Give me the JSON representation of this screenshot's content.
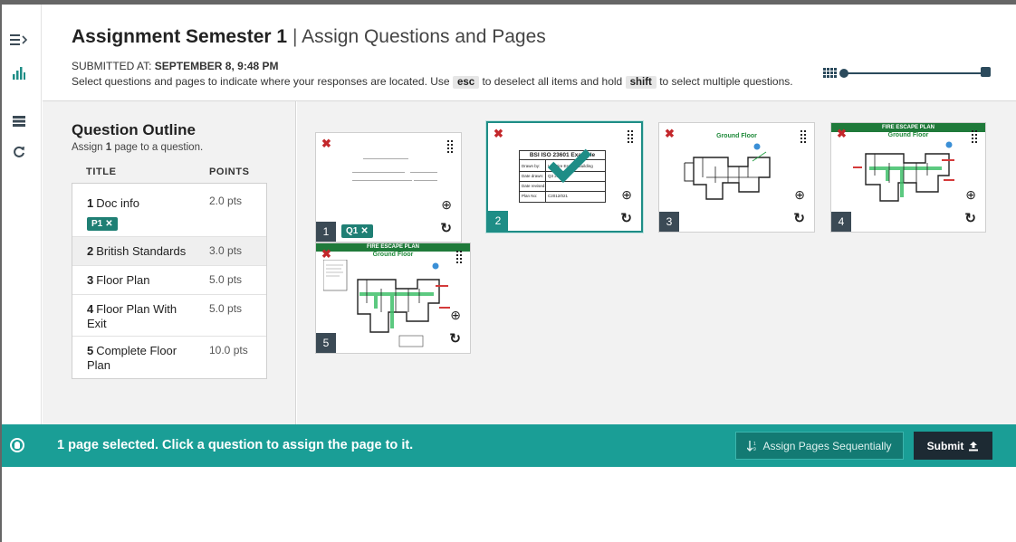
{
  "header": {
    "title_bold": "Assignment Semester 1",
    "title_sep": "|",
    "title_rest": "Assign Questions and Pages",
    "submitted_label": "SUBMITTED AT:",
    "submitted_value": "SEPTEMBER 8, 9:48 PM",
    "instr_1": "Select questions and pages to indicate where your responses are located. Use",
    "key_esc": "esc",
    "instr_2": "to deselect all items and hold",
    "key_shift": "shift",
    "instr_3": "to select multiple questions.",
    "zoom_level": 0.0
  },
  "rail": {
    "icons": [
      "menu-toggle-icon",
      "bar-chart-icon",
      "outline-icon",
      "refresh-icon"
    ]
  },
  "outline": {
    "title": "Question Outline",
    "sub_pre": "Assign",
    "sub_count": "1",
    "sub_post": "page to a question.",
    "col_title": "TITLE",
    "col_points": "POINTS",
    "questions": [
      {
        "num": "1",
        "name": "Doc info",
        "points": "2.0 pts",
        "tag": "P1"
      },
      {
        "num": "2",
        "name": "British Standards",
        "points": "3.0 pts"
      },
      {
        "num": "3",
        "name": "Floor Plan",
        "points": "5.0 pts"
      },
      {
        "num": "4",
        "name": "Floor Plan With Exit",
        "points": "5.0 pts"
      },
      {
        "num": "5",
        "name": "Complete Floor Plan",
        "points": "10.0 pts"
      }
    ]
  },
  "pages": [
    {
      "num": "1",
      "tag": "Q1",
      "selected": false
    },
    {
      "num": "2",
      "selected": true,
      "table_title": "BSI ISO 23601 Example",
      "cells": [
        "Drawn by:",
        "Date drawn:",
        "Date revised:",
        "Plan No:"
      ],
      "cell_values": [
        "Lec Fire Escape Building",
        "Q3 2012",
        "",
        "C2012/021"
      ]
    },
    {
      "num": "3",
      "selected": false,
      "heading": "Ground Floor"
    },
    {
      "num": "4",
      "selected": false,
      "banner": "FIRE ESCAPE PLAN",
      "heading": "Ground Floor"
    },
    {
      "num": "5",
      "selected": false,
      "banner": "FIRE ESCAPE PLAN",
      "heading": "Ground Floor"
    }
  ],
  "bar": {
    "message": "1 page selected. Click a question to assign the page to it.",
    "seq_label": "Assign Pages Sequentially",
    "submit_label": "Submit"
  },
  "colors": {
    "teal": "#1a9e96",
    "dark": "#1d2a33",
    "remove": "#c3272b"
  }
}
